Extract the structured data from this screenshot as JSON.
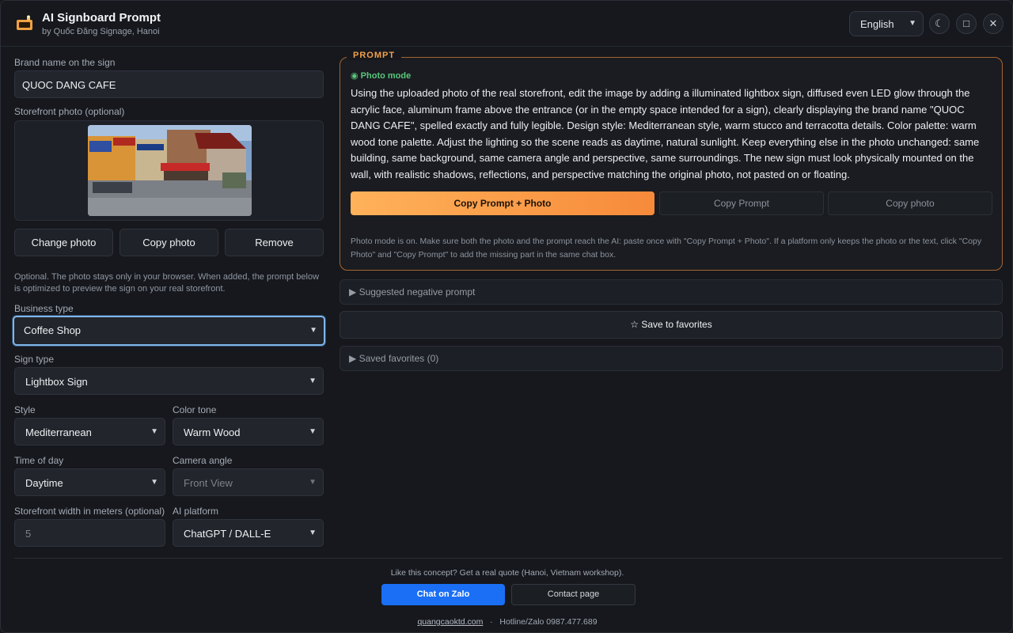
{
  "header": {
    "title": "AI Signboard Prompt",
    "subtitle": "by Quốc Đăng Signage, Hanoi",
    "language": "English"
  },
  "form": {
    "brand_label": "Brand name on the sign",
    "brand_value": "QUOC DANG CAFE",
    "photo_label": "Storefront photo (optional)",
    "change_photo": "Change photo",
    "copy_photo": "Copy photo",
    "remove": "Remove",
    "note": "Optional. The photo stays only in your browser. When added, the prompt below is optimized to preview the sign on your real storefront.",
    "business_type_label": "Business type",
    "business_type_value": "Coffee Shop",
    "sign_type_label": "Sign type",
    "sign_type_value": "Lightbox Sign",
    "style_label": "Style",
    "style_value": "Mediterranean",
    "color_tone_label": "Color tone",
    "color_tone_value": "Warm Wood",
    "time_label": "Time of day",
    "time_value": "Daytime",
    "camera_label": "Camera angle",
    "camera_value": "Front View",
    "width_label": "Storefront width in meters (optional)",
    "width_placeholder": "5",
    "platform_label": "AI platform",
    "platform_value": "ChatGPT / DALL-E"
  },
  "prompt": {
    "tag": "PROMPT",
    "mode": "Photo mode",
    "text": "Using the uploaded photo of the real storefront, edit the image by adding a illuminated lightbox sign, diffused even LED glow through the acrylic face, aluminum frame above the entrance (or in the empty space intended for a sign), clearly displaying the brand name \"QUOC DANG CAFE\", spelled exactly and fully legible. Design style: Mediterranean style, warm stucco and terracotta details. Color palette: warm wood tone palette. Adjust the lighting so the scene reads as daytime, natural sunlight. Keep everything else in the photo unchanged: same building, same background, same camera angle and perspective, same surroundings. The new sign must look physically mounted on the wall, with realistic shadows, reflections, and perspective matching the original photo, not pasted on or floating.",
    "copy_both": "Copy Prompt + Photo",
    "copy_prompt": "Copy Prompt",
    "copy_photo": "Copy photo",
    "note": "Photo mode is on. Make sure both the photo and the prompt reach the AI: paste once with \"Copy Prompt + Photo\". If a platform only keeps the photo or the text, click \"Copy Photo\" and \"Copy Prompt\" to add the missing part in the same chat box."
  },
  "negative": {
    "label": "Suggested negative prompt"
  },
  "favorites": {
    "save": "☆ Save to favorites",
    "saved": "Saved favorites (0)"
  },
  "footer": {
    "cta": "Like this concept? Get a real quote (Hanoi, Vietnam workshop).",
    "zalo": "Chat on Zalo",
    "contact": "Contact page",
    "site": "quangcaoktd.com",
    "hotline": "Hotline/Zalo  0987.477.689"
  },
  "colors": {
    "accent": "#f68a3a",
    "zalo": "#1a6ff5",
    "focus": "#7fb6ea"
  }
}
